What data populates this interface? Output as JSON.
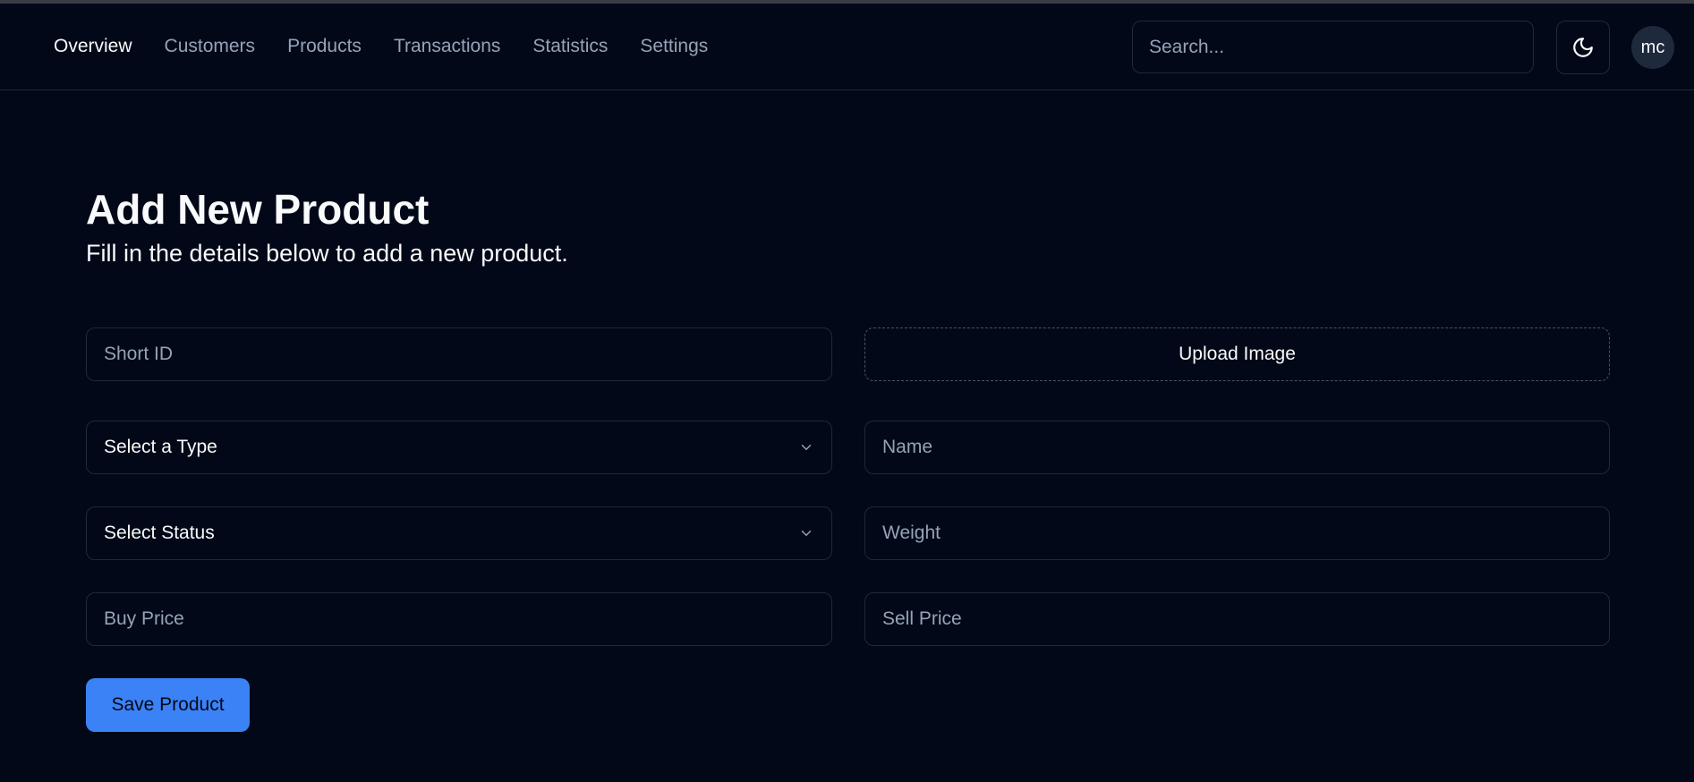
{
  "nav": {
    "items": [
      {
        "label": "Overview",
        "active": true
      },
      {
        "label": "Customers",
        "active": false
      },
      {
        "label": "Products",
        "active": false
      },
      {
        "label": "Transactions",
        "active": false
      },
      {
        "label": "Statistics",
        "active": false
      },
      {
        "label": "Settings",
        "active": false
      }
    ],
    "search_placeholder": "Search...",
    "theme_icon": "moon-icon",
    "avatar_initials": "mc"
  },
  "page": {
    "title": "Add New Product",
    "subtitle": "Fill in the details below to add a new product."
  },
  "form": {
    "short_id_placeholder": "Short ID",
    "upload_label": "Upload Image",
    "type_select": "Select a Type",
    "name_placeholder": "Name",
    "status_select": "Select Status",
    "weight_placeholder": "Weight",
    "buy_price_placeholder": "Buy Price",
    "sell_price_placeholder": "Sell Price",
    "save_label": "Save Product"
  },
  "colors": {
    "background": "#020817",
    "border": "#1e293b",
    "accent": "#3b82f6",
    "muted_text": "#94a3b8"
  }
}
